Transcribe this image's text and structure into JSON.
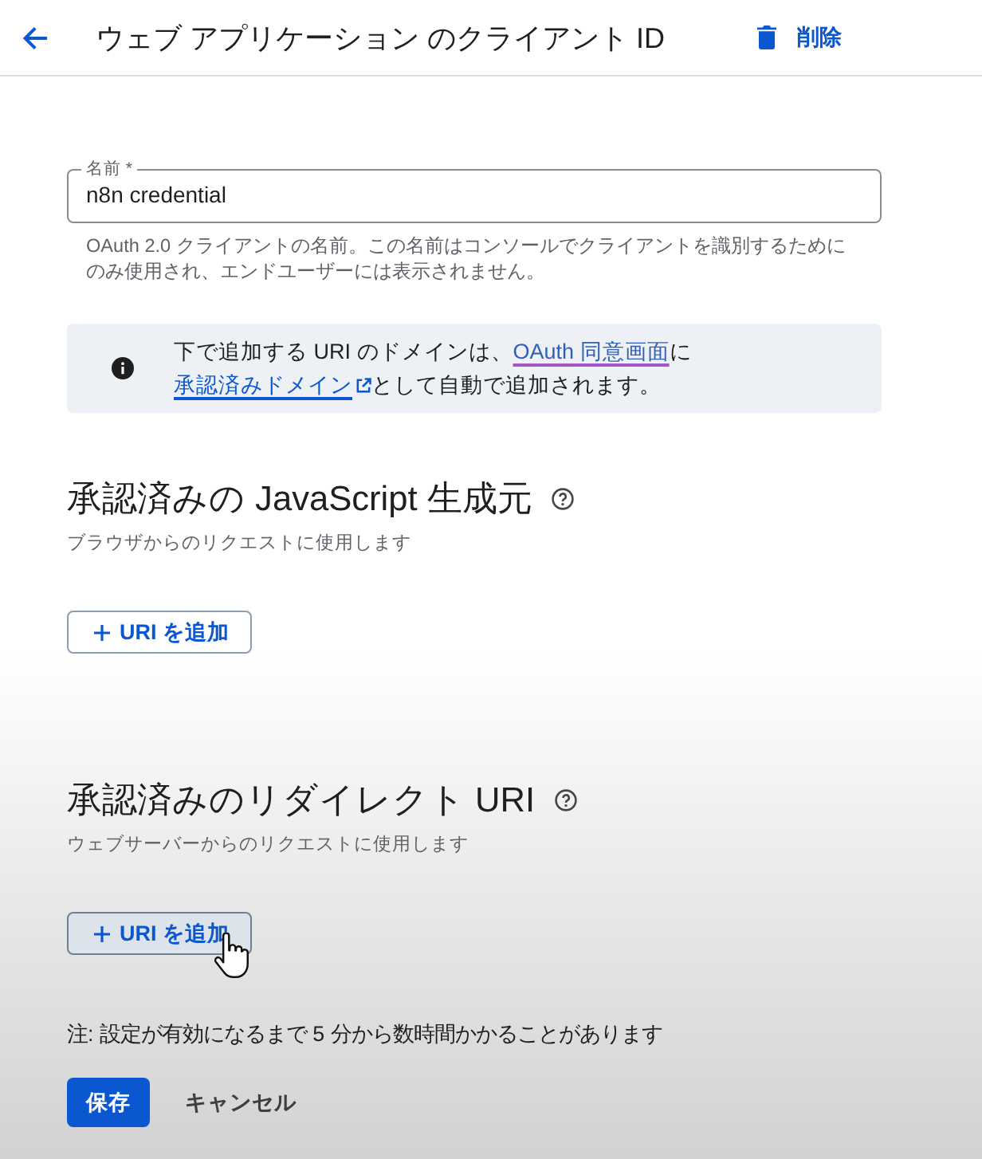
{
  "header": {
    "title": "ウェブ アプリケーション のクライアント ID",
    "delete_label": "削除"
  },
  "name_field": {
    "label": "名前 *",
    "value": "n8n credential",
    "helper": "OAuth 2.0 クライアントの名前。この名前はコンソールでクライアントを識別するためにのみ使用され、エンドユーザーには表示されません。"
  },
  "info_banner": {
    "message": [
      {
        "kind": "text",
        "text": "下で追加する URI のドメインは、"
      },
      {
        "kind": "link",
        "text": "OAuth 同意画面",
        "visited": true,
        "external": false
      },
      {
        "kind": "text",
        "text": "に"
      },
      {
        "kind": "link",
        "text": "承認済みドメイン",
        "visited": false,
        "external": true
      },
      {
        "kind": "text",
        "text": "として自動で追加されます。"
      }
    ]
  },
  "sections": [
    {
      "title": "承認済みの JavaScript 生成元",
      "description": "ブラウザからのリクエストに使用します",
      "add_button": {
        "label": "URI を追加",
        "hovered": false
      }
    },
    {
      "title": "承認済みのリダイレクト URI",
      "description": "ウェブサーバーからのリクエストに使用します",
      "add_button": {
        "label": "URI を追加",
        "hovered": true
      }
    }
  ],
  "note": "注: 設定が有効になるまで 5 分から数時間かかることがあります",
  "actions": [
    {
      "kind": "filled",
      "label": "保存"
    },
    {
      "kind": "text",
      "label": "キャンセル"
    }
  ]
}
